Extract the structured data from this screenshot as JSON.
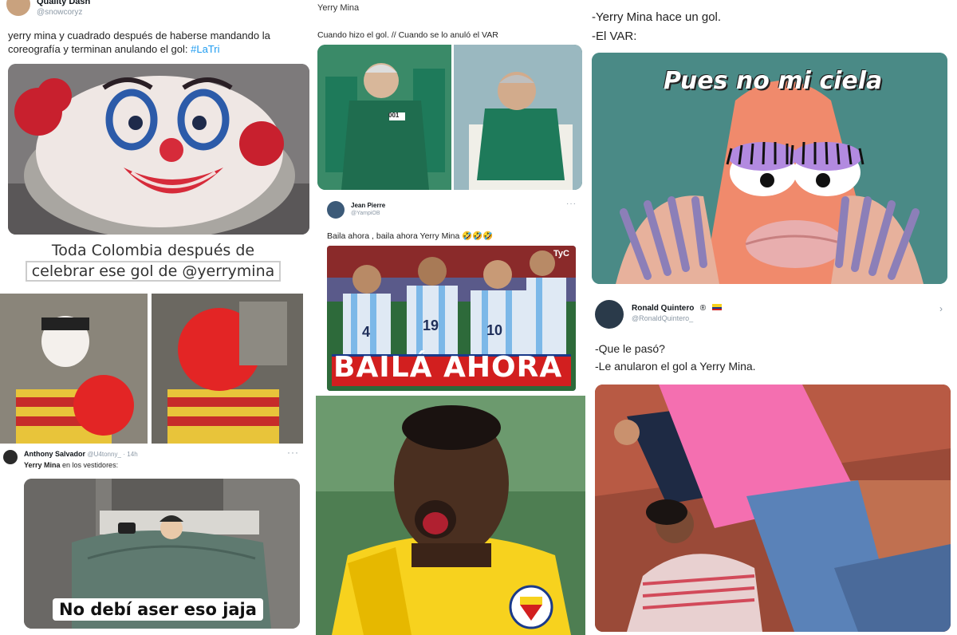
{
  "col1": {
    "tweet1": {
      "username": "Quality Dash",
      "handle": "@snowcoryz",
      "text": "yerry mina y cuadrado después de haberse mandando la coreografía y terminan anulando el gol:",
      "hashtag": "#LaTri"
    },
    "meme2": {
      "caption_line1": "Toda Colombia después de",
      "caption_line2": "celebrar ese gol de @yerrymina"
    },
    "tweet3": {
      "username": "Anthony Salvador",
      "handle": "@U4tonny_",
      "time": "· 14h",
      "text_bold": "Yerry Mina",
      "text_rest": " en los vestidores:",
      "caption": "No debí aser eso jaja"
    }
  },
  "col2": {
    "tweet1": {
      "username": "Yerry Mina",
      "text": "Cuando hizo el gol. // Cuando se lo anuló el VAR",
      "jersey_number": "001"
    },
    "tweet2": {
      "username": "Jean Pierre",
      "handle": "@YampiOB",
      "text": "Baila ahora , baila ahora Yerry Mina 🤣🤣🤣",
      "caption": "BAILÁ AHORA",
      "broadcaster": "TyC",
      "jersey_numbers": [
        "4",
        "19",
        "10"
      ]
    }
  },
  "col3": {
    "tweet1": {
      "line1": "-Yerry Mina hace un gol.",
      "line2": "-El VAR:",
      "caption": "Pues no mi ciela"
    },
    "tweet2": {
      "username": "Ronald Quintero",
      "badge": "®",
      "handle": "@RonaldQuintero_",
      "line1": "-Que le pasó?",
      "line2": "-Le anularon el gol a Yerry Mina."
    }
  },
  "colors": {
    "hashtag": "#1d9bf0",
    "colombia_yellow": "#f7d21e",
    "argentina_blue": "#7cb8e8",
    "patrick_pink": "#f08a6c",
    "squid_green": "#1e7a5a"
  }
}
